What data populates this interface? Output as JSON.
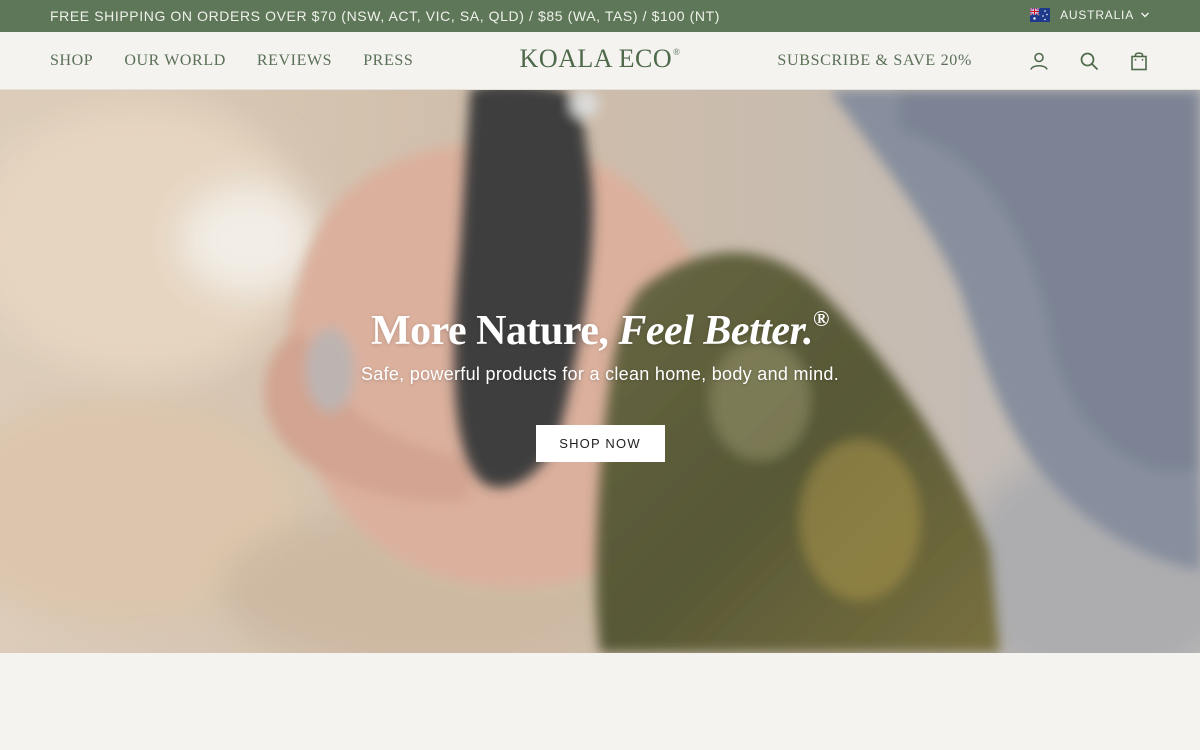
{
  "announcement": {
    "text": "FREE SHIPPING ON ORDERS OVER $70 (NSW, ACT, VIC, SA, QLD) / $85 (WA, TAS) / $100 (NT)",
    "country": "AUSTRALIA",
    "flag_icon": "australia-flag-icon"
  },
  "header": {
    "nav": [
      "SHOP",
      "OUR WORLD",
      "REVIEWS",
      "PRESS"
    ],
    "logo": "KOALA ECO",
    "logo_mark": "®",
    "subscribe": "SUBSCRIBE & SAVE 20%",
    "icons": [
      "account-icon",
      "search-icon",
      "cart-icon"
    ]
  },
  "hero": {
    "title_plain": "More Nature,",
    "title_italic": "Feel Better.",
    "title_mark": "®",
    "subtitle": "Safe, powerful products for a clean home, body and mind.",
    "cta": "SHOP NOW"
  },
  "colors": {
    "announcement_bg": "#5f7759",
    "brand_green": "#4e6a4b",
    "page_bg": "#f4f3f0"
  }
}
